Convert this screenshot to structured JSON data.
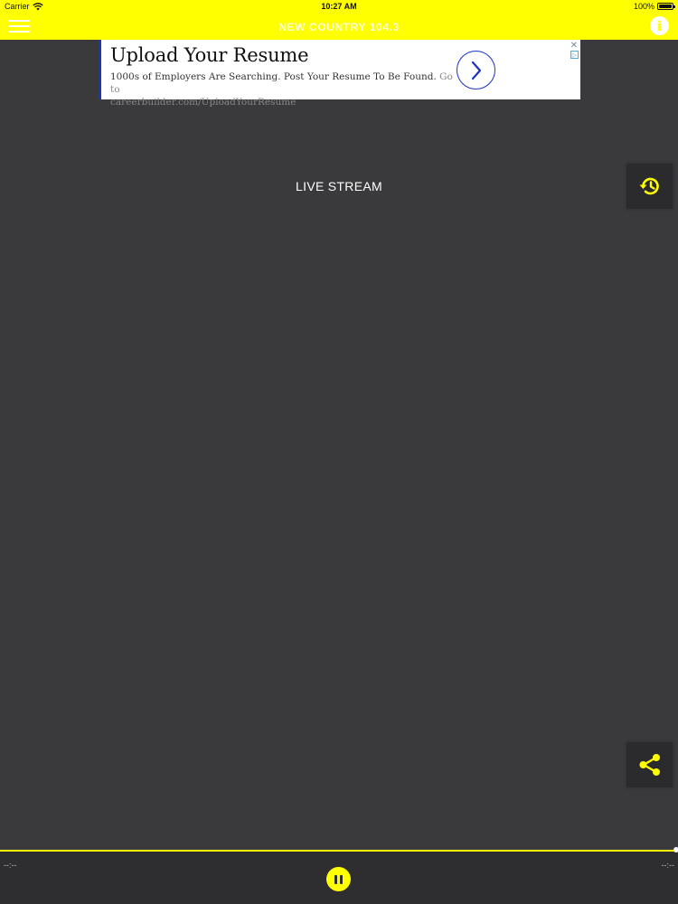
{
  "status_bar": {
    "carrier": "Carrier",
    "time": "10:27 AM",
    "battery": "100%"
  },
  "nav": {
    "title": "NEW COUNTRY 104.3",
    "info_glyph": "i"
  },
  "ad": {
    "title": "Upload Your Resume",
    "body": "1000s of Employers Are Searching. Post Your Resume To Be Found.",
    "goto": "Go to",
    "url": "careerbuilder.com/UploadYourResume",
    "close_glyph": "✕",
    "choices_glyph": "▷"
  },
  "main": {
    "stream_label": "LIVE STREAM"
  },
  "player": {
    "elapsed": "--:--",
    "remaining": "--:--"
  },
  "colors": {
    "accent": "#ffff00",
    "background": "#3a393b",
    "ad_accent": "#1c32c4"
  },
  "icons": {
    "menu": "hamburger-icon",
    "info": "info-icon",
    "history": "history-icon",
    "share": "share-icon",
    "pause": "pause-icon",
    "ad_arrow": "chevron-right-icon"
  }
}
